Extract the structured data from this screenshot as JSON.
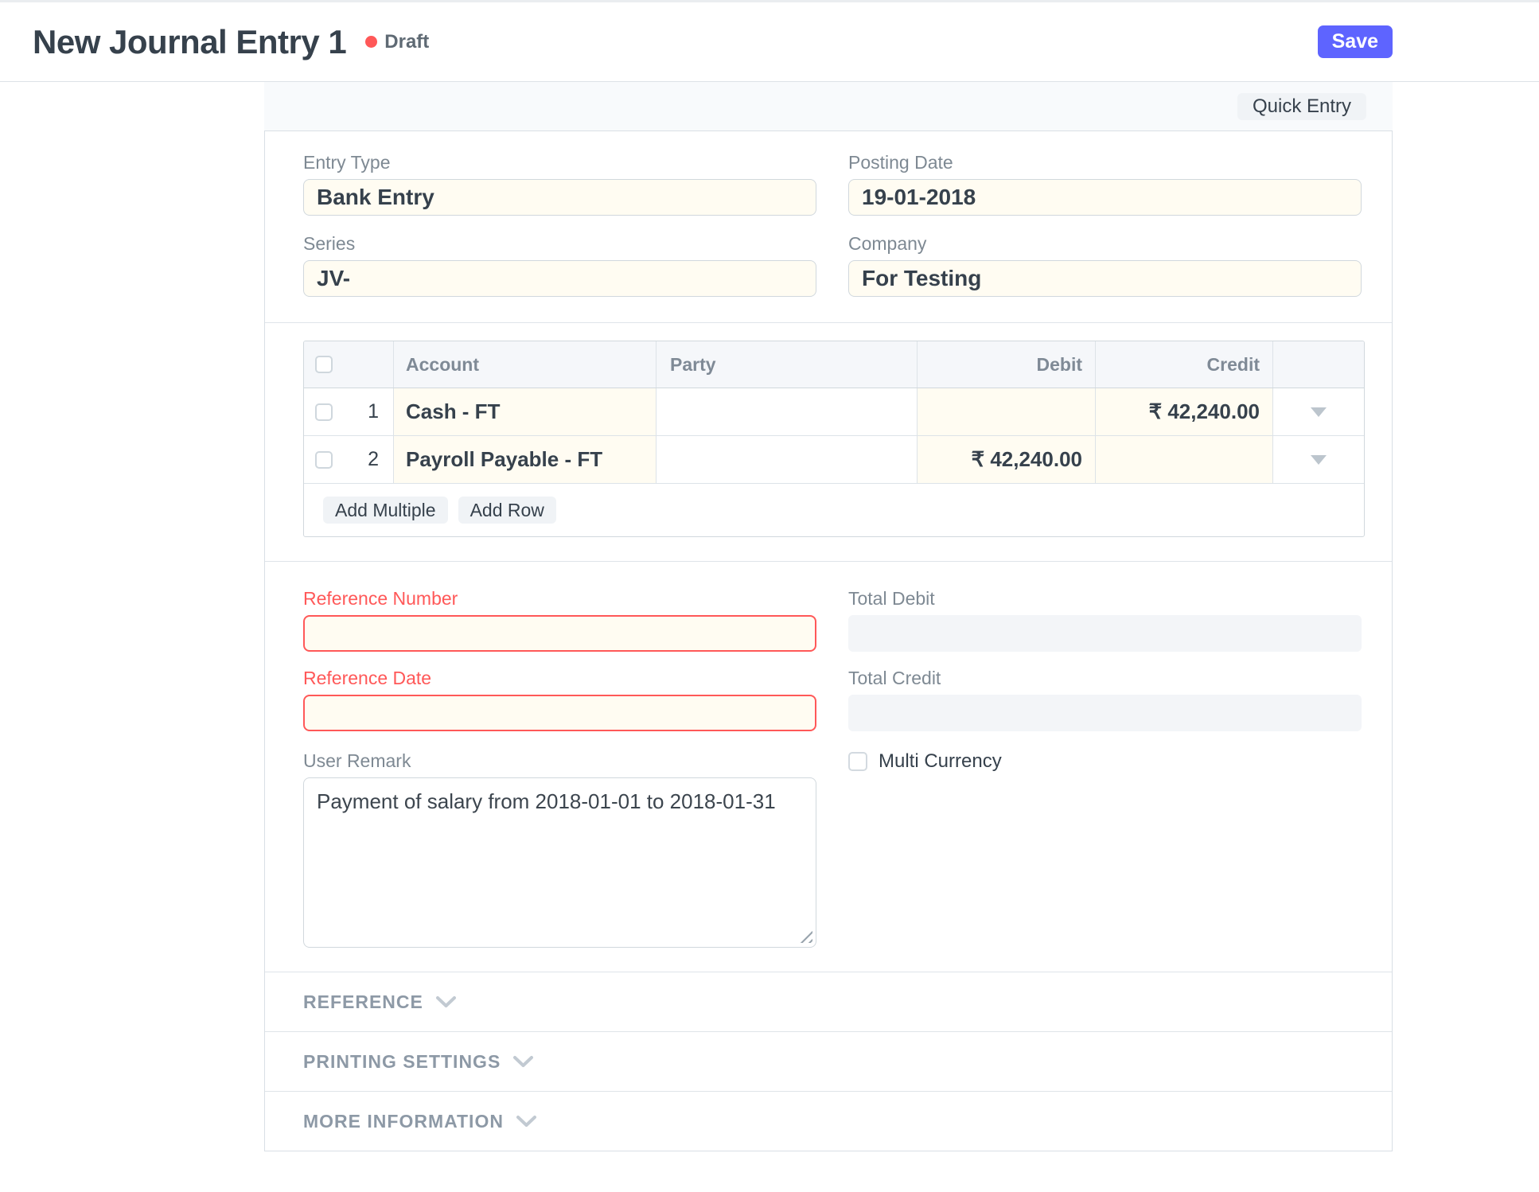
{
  "header": {
    "title": "New Journal Entry 1",
    "status": "Draft",
    "save_label": "Save"
  },
  "toolbar": {
    "quick_entry_label": "Quick Entry"
  },
  "form": {
    "fields": {
      "entry_type": {
        "label": "Entry Type",
        "value": "Bank Entry"
      },
      "posting_date": {
        "label": "Posting Date",
        "value": "19-01-2018"
      },
      "series": {
        "label": "Series",
        "value": "JV-"
      },
      "company": {
        "label": "Company",
        "value": "For Testing"
      },
      "reference_number": {
        "label": "Reference Number",
        "value": ""
      },
      "reference_date": {
        "label": "Reference Date",
        "value": ""
      },
      "user_remark": {
        "label": "User Remark",
        "value": "Payment of salary from 2018-01-01 to 2018-01-31"
      },
      "total_debit": {
        "label": "Total Debit",
        "value": ""
      },
      "total_credit": {
        "label": "Total Credit",
        "value": ""
      },
      "multi_currency": {
        "label": "Multi Currency",
        "checked": false
      }
    },
    "table": {
      "columns": [
        "Account",
        "Party",
        "Debit",
        "Credit"
      ],
      "rows": [
        {
          "idx": "1",
          "account": "Cash - FT",
          "party": "",
          "debit": "",
          "credit": "₹ 42,240.00"
        },
        {
          "idx": "2",
          "account": "Payroll Payable - FT",
          "party": "",
          "debit": "₹ 42,240.00",
          "credit": ""
        }
      ],
      "buttons": {
        "add_multiple": "Add Multiple",
        "add_row": "Add Row"
      }
    },
    "sections": [
      {
        "label": "REFERENCE"
      },
      {
        "label": "PRINTING SETTINGS"
      },
      {
        "label": "MORE INFORMATION"
      }
    ]
  },
  "colors": {
    "primary": "#5e64ff",
    "status_draft": "#ff5858",
    "required_red": "#ff5858",
    "input_filled_bg": "#fffcf2",
    "toolbar_bg": "#f8fafc",
    "table_header_bg": "#f5f7fa"
  }
}
